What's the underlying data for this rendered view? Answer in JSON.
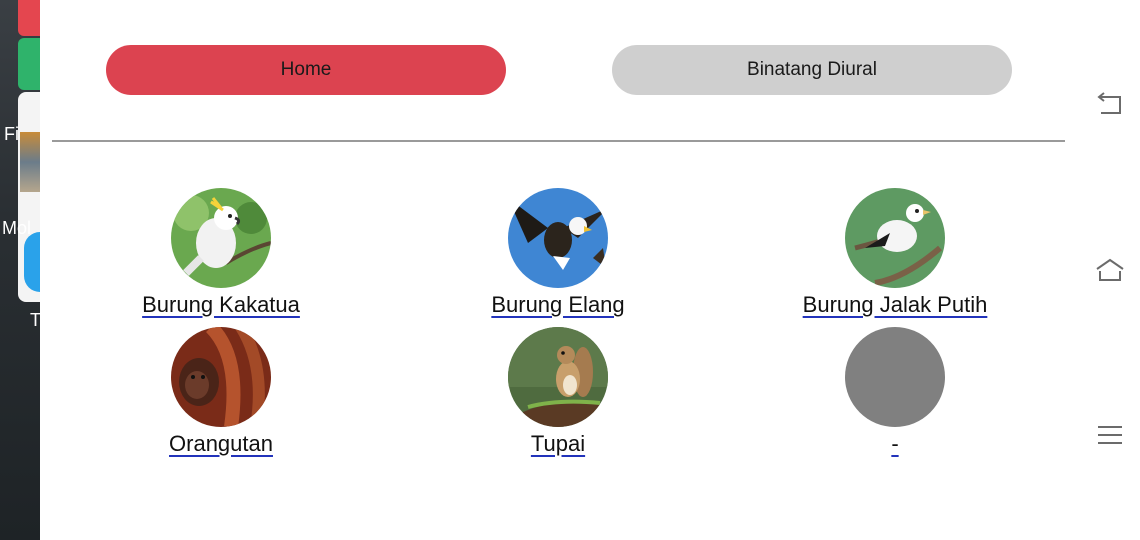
{
  "background_launcher": {
    "fragments": [
      "Fi",
      "Mol",
      "T"
    ]
  },
  "tabs": {
    "home_label": "Home",
    "diurnal_label": "Binatang Diural"
  },
  "animals": [
    {
      "name": "Burung Kakatua",
      "image": "cockatoo"
    },
    {
      "name": "Burung Elang",
      "image": "eagle"
    },
    {
      "name": "Burung Jalak Putih",
      "image": "white-starling"
    },
    {
      "name": "Orangutan",
      "image": "orangutan"
    },
    {
      "name": "Tupai",
      "image": "squirrel"
    },
    {
      "name": "-",
      "image": "placeholder"
    }
  ],
  "system_nav": {
    "icons": [
      "back-icon",
      "home-icon",
      "menu-icon"
    ]
  },
  "colors": {
    "home_tab": "#dc4350",
    "diurnal_tab": "#cfcfcf",
    "placeholder_avatar": "#808080"
  }
}
